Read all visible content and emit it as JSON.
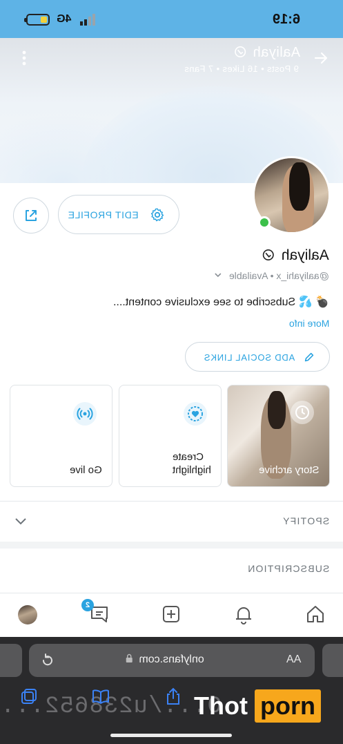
{
  "status_bar": {
    "time": "6:19",
    "network": "4G"
  },
  "header": {
    "name": "Aaliyah",
    "stats": "9 Posts • 16 Likes • 7 Fans"
  },
  "profile": {
    "edit_label": "EDIT PROFILE",
    "name": "Aaliyah",
    "handle": "@aaliyahi_x • Available",
    "bio": "Subscribe to see exclusive content....",
    "more_info": "More info",
    "social_label": "ADD SOCIAL LINKS"
  },
  "cards": {
    "story": "Story archive",
    "highlight_line1": "Create",
    "highlight_line2": "highlight",
    "live": "Go live"
  },
  "sections": {
    "spotify": "SPOTIFY",
    "subscription": "SUBSCRIPTION"
  },
  "nav": {
    "messages_badge": "2"
  },
  "browser": {
    "aa": "AA",
    "url": "onlyfans.com",
    "address_echo": "O.../u238652..."
  },
  "watermark": {
    "left": "Thot",
    "right": "porn"
  },
  "colors": {
    "accent": "#2aa3e0",
    "status_bar": "#5eb3e6",
    "online": "#3cc04a",
    "watermark": "#f7a71c"
  }
}
